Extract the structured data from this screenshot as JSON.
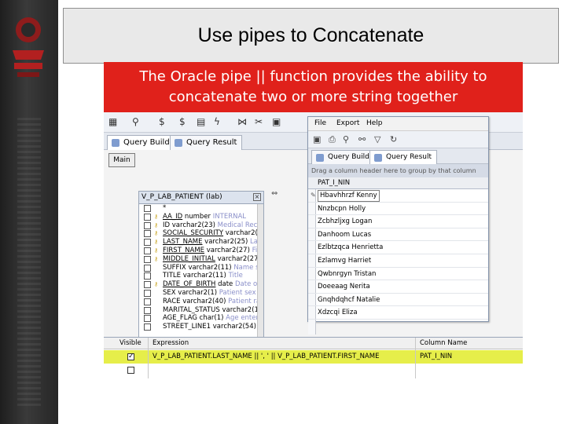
{
  "slide": {
    "title": "Use pipes to Concatenate",
    "description_line1": "The Oracle pipe || function provides the ability to",
    "description_line2": "concatenate two or more string together"
  },
  "logo": {
    "alt_text": "JUST DUSTIN"
  },
  "toolbar": {
    "icons": [
      "grid-view-icon",
      "binoculars-icon",
      "dollar-icon",
      "currency-icon",
      "report-icon",
      "lightning-icon",
      "split-icon",
      "cut-icon",
      "save-icon"
    ]
  },
  "tabs": [
    {
      "label": "Query Builder",
      "active": true
    },
    {
      "label": "Query Result",
      "active": false
    }
  ],
  "main_button": "Main",
  "entity": {
    "header": "V_P_LAB_PATIENT (lab)",
    "rows": [
      {
        "name": "*",
        "type": "",
        "desc": "",
        "key": false,
        "underline": false
      },
      {
        "name": "AA_ID",
        "type": "number",
        "desc": "INTERNAL",
        "key": true,
        "underline": true
      },
      {
        "name": "ID",
        "type": "varchar2(23)",
        "desc": "Medical Reco",
        "key": true,
        "underline": false
      },
      {
        "name": "SOCIAL_SECURITY",
        "type": "varchar2(",
        "desc": "",
        "key": true,
        "underline": true
      },
      {
        "name": "LAST_NAME",
        "type": "varchar2(25)",
        "desc": "La",
        "key": true,
        "underline": true
      },
      {
        "name": "FIRST_NAME",
        "type": "varchar2(27)",
        "desc": "Fi",
        "key": true,
        "underline": true
      },
      {
        "name": "MIDDLE_INITIAL",
        "type": "varchar2(27",
        "desc": "",
        "key": true,
        "underline": true
      },
      {
        "name": "SUFFIX",
        "type": "varchar2(11)",
        "desc": "Name s",
        "key": false,
        "underline": false
      },
      {
        "name": "TITLE",
        "type": "varchar2(11)",
        "desc": "Title",
        "key": false,
        "underline": false
      },
      {
        "name": "DATE_OF_BIRTH",
        "type": "date",
        "desc": "Date of",
        "key": true,
        "underline": true
      },
      {
        "name": "SEX",
        "type": "varchar2(1)",
        "desc": "Patient sex",
        "key": false,
        "underline": false
      },
      {
        "name": "RACE",
        "type": "varchar2(40)",
        "desc": "Patient ra",
        "key": false,
        "underline": false
      },
      {
        "name": "MARITAL_STATUS",
        "type": "varchar2(1",
        "desc": "",
        "key": false,
        "underline": false
      },
      {
        "name": "AGE_FLAG",
        "type": "char(1)",
        "desc": "Age entere",
        "key": false,
        "underline": false
      },
      {
        "name": "STREET_LINE1",
        "type": "varchar2(54)",
        "desc": "",
        "key": false,
        "underline": false
      }
    ]
  },
  "query_result": {
    "menu": [
      "File",
      "Export",
      "Help"
    ],
    "tabs": [
      {
        "label": "Query Builder"
      },
      {
        "label": "Query Result"
      }
    ],
    "drag_hint": "Drag a column header here to group by that column",
    "column": "PAT_I_NIN",
    "rows": [
      "Hbavhhrzf Kenny",
      "Nnzbcpn Holly",
      "Zcbhzljxg Logan",
      "Danhoom Lucas",
      "Ezlbtzqca Henrietta",
      "Ezlamvg Harriet",
      "Qwbnrgyn Tristan",
      "Doeeaag Nerita",
      "Gnqhdqhcf Natalie",
      "Xdzcqi Eliza"
    ]
  },
  "expression_grid": {
    "headers": {
      "visible": "Visible",
      "expression": "Expression",
      "column_name": "Column Name"
    },
    "rows": [
      {
        "checked": true,
        "expression": "V_P_LAB_PATIENT.LAST_NAME || ', ' || V_P_LAB_PATIENT.FIRST_NAME",
        "column_name": "PAT_I_NIN"
      },
      {
        "checked": false,
        "expression": "",
        "column_name": ""
      }
    ]
  }
}
